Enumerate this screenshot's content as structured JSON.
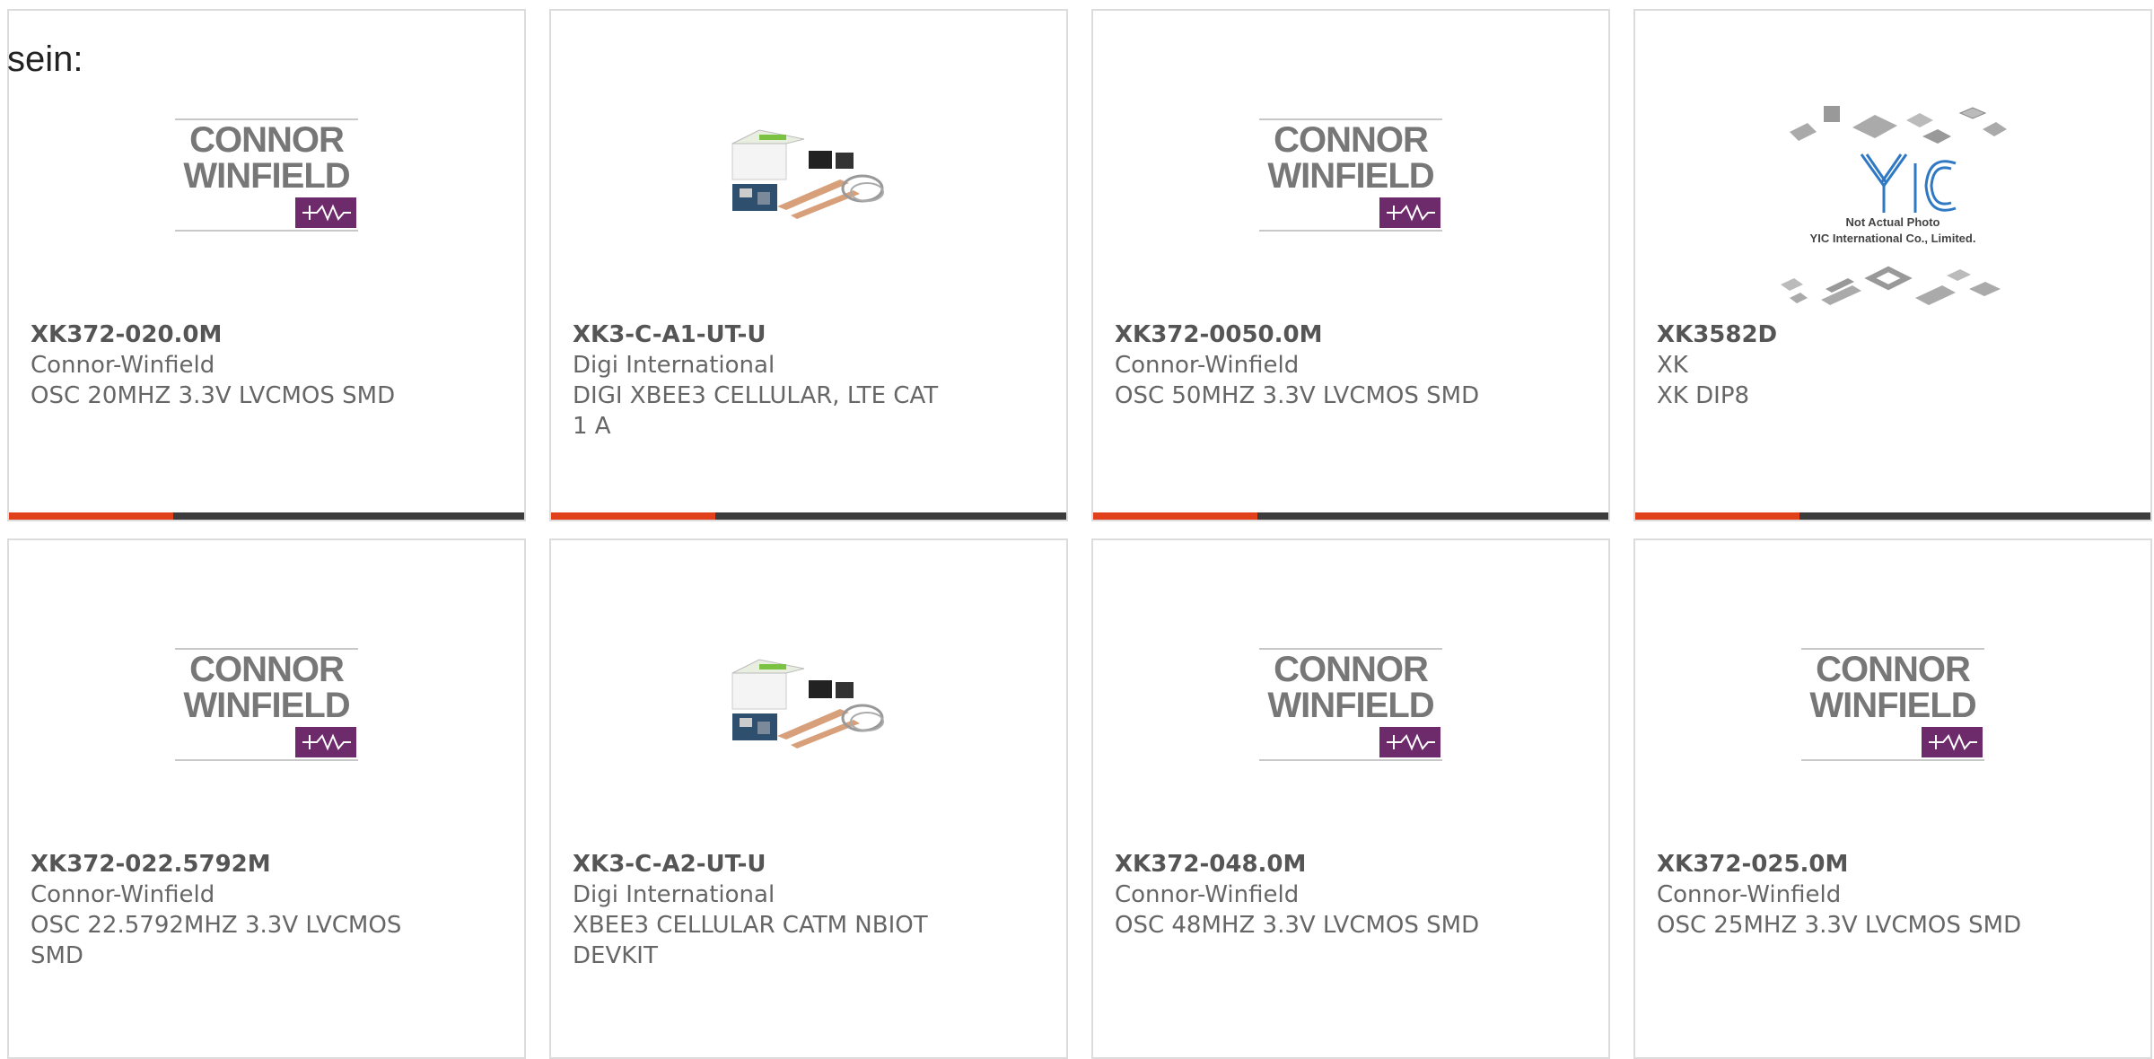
{
  "heading": "sein:",
  "colors": {
    "accent": "#e0401a",
    "bar": "#3c3c3c",
    "logo_purple": "#6e2b6b"
  },
  "logo_text": {
    "connor": "CONNOR",
    "winfield": "WINFIELD"
  },
  "yic_caption": {
    "line1": "Not Actual Photo",
    "line2": "YIC International Co., Limited."
  },
  "products": [
    {
      "part": "XK372-020.0M",
      "manufacturer": "Connor-Winfield",
      "description": "OSC 20MHZ 3.3V LVCMOS SMD",
      "image": "connor-winfield-logo"
    },
    {
      "part": "XK3-C-A1-UT-U",
      "manufacturer": "Digi International",
      "description": "DIGI XBEE3 CELLULAR, LTE CAT 1 A",
      "image": "xbee-kit-photo"
    },
    {
      "part": "XK372-0050.0M",
      "manufacturer": "Connor-Winfield",
      "description": "OSC 50MHZ 3.3V LVCMOS SMD",
      "image": "connor-winfield-logo"
    },
    {
      "part": "XK3582D",
      "manufacturer": "XK",
      "description": "XK DIP8",
      "image": "yic-placeholder"
    },
    {
      "part": "XK372-022.5792M",
      "manufacturer": "Connor-Winfield",
      "description": "OSC 22.5792MHZ 3.3V LVCMOS SMD",
      "image": "connor-winfield-logo"
    },
    {
      "part": "XK3-C-A2-UT-U",
      "manufacturer": "Digi International",
      "description": "XBEE3 CELLULAR CATM NBIOT DEVKIT",
      "image": "xbee-kit-photo"
    },
    {
      "part": "XK372-048.0M",
      "manufacturer": "Connor-Winfield",
      "description": "OSC 48MHZ 3.3V LVCMOS SMD",
      "image": "connor-winfield-logo"
    },
    {
      "part": "XK372-025.0M",
      "manufacturer": "Connor-Winfield",
      "description": "OSC 25MHZ 3.3V LVCMOS SMD",
      "image": "connor-winfield-logo"
    }
  ]
}
